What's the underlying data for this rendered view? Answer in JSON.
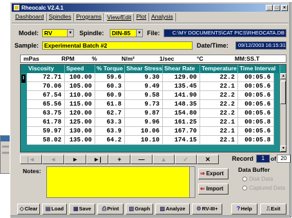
{
  "window": {
    "title": "Rheocalc V2.4.1"
  },
  "tabs": [
    "Dashboard",
    "Spindles",
    "Programs",
    "View/Edit",
    "Plot",
    "Analysis"
  ],
  "form": {
    "model_label": "Model:",
    "model_value": "RV",
    "spindle_label": "Spindle:",
    "spindle_value": "DIN-85",
    "file_label": "File:",
    "file_value": "C:\\MY DOCUMENTS\\CAT PICS\\RHEOCATA.DB",
    "sample_label": "Sample:",
    "sample_value": "Experimental Batch #2",
    "datetime_label": "Date/Time:",
    "datetime_value": "09/12/2003 16:15:31"
  },
  "units": [
    "mPas",
    "RPM",
    "%",
    "N/m²",
    "1/sec",
    "°C",
    "MM:SS.T"
  ],
  "table": {
    "columns": [
      "Viscosity",
      "Speed",
      "% Torque",
      "Shear Stress",
      "Shear Rate",
      "Temperature",
      "Time Interval"
    ],
    "rows": [
      [
        "72.71",
        "100.00",
        "59.6",
        "9.30",
        "129.00",
        "22.2",
        "00:05.6"
      ],
      [
        "70.06",
        "105.00",
        "60.3",
        "9.49",
        "135.45",
        "22.1",
        "00:05.6"
      ],
      [
        "67.54",
        "110.00",
        "60.9",
        "9.58",
        "141.90",
        "22.2",
        "00:05.6"
      ],
      [
        "65.56",
        "115.00",
        "61.8",
        "9.73",
        "148.35",
        "22.2",
        "00:05.6"
      ],
      [
        "63.75",
        "120.00",
        "62.7",
        "9.87",
        "154.80",
        "22.2",
        "00:05.6"
      ],
      [
        "61.78",
        "125.00",
        "63.3",
        "9.96",
        "161.25",
        "22.1",
        "00:05.8"
      ],
      [
        "59.97",
        "130.00",
        "63.9",
        "10.06",
        "167.70",
        "22.1",
        "00:05.6"
      ],
      [
        "58.02",
        "135.00",
        "64.2",
        "10.10",
        "174.15",
        "22.1",
        "00:05.8"
      ]
    ],
    "selected_row_marker": "I"
  },
  "navigator": {
    "buttons": [
      "|◄",
      "◄",
      "►",
      "►|",
      "+",
      "—",
      "▲",
      "✓",
      "✕",
      "↻"
    ],
    "record_label": "Record",
    "record_current": "1",
    "record_of": "of",
    "record_total": "20"
  },
  "notes": {
    "label": "Notes:"
  },
  "side_buttons": {
    "export": "Export",
    "import": "Import"
  },
  "data_buffer": {
    "title": "Data Buffer",
    "option1": "Disk Data",
    "option2": "Captured Data"
  },
  "toolbar": [
    "Clear",
    "Load",
    "Save",
    "Print",
    "Graph",
    "Analyze",
    "RV-III+",
    "Help",
    "Exit"
  ],
  "colors": {
    "title_bar": "#0a246a",
    "grid_teal": "#1e8f8f",
    "field_yellow": "#ffff00",
    "face": "#d4d0c8"
  }
}
